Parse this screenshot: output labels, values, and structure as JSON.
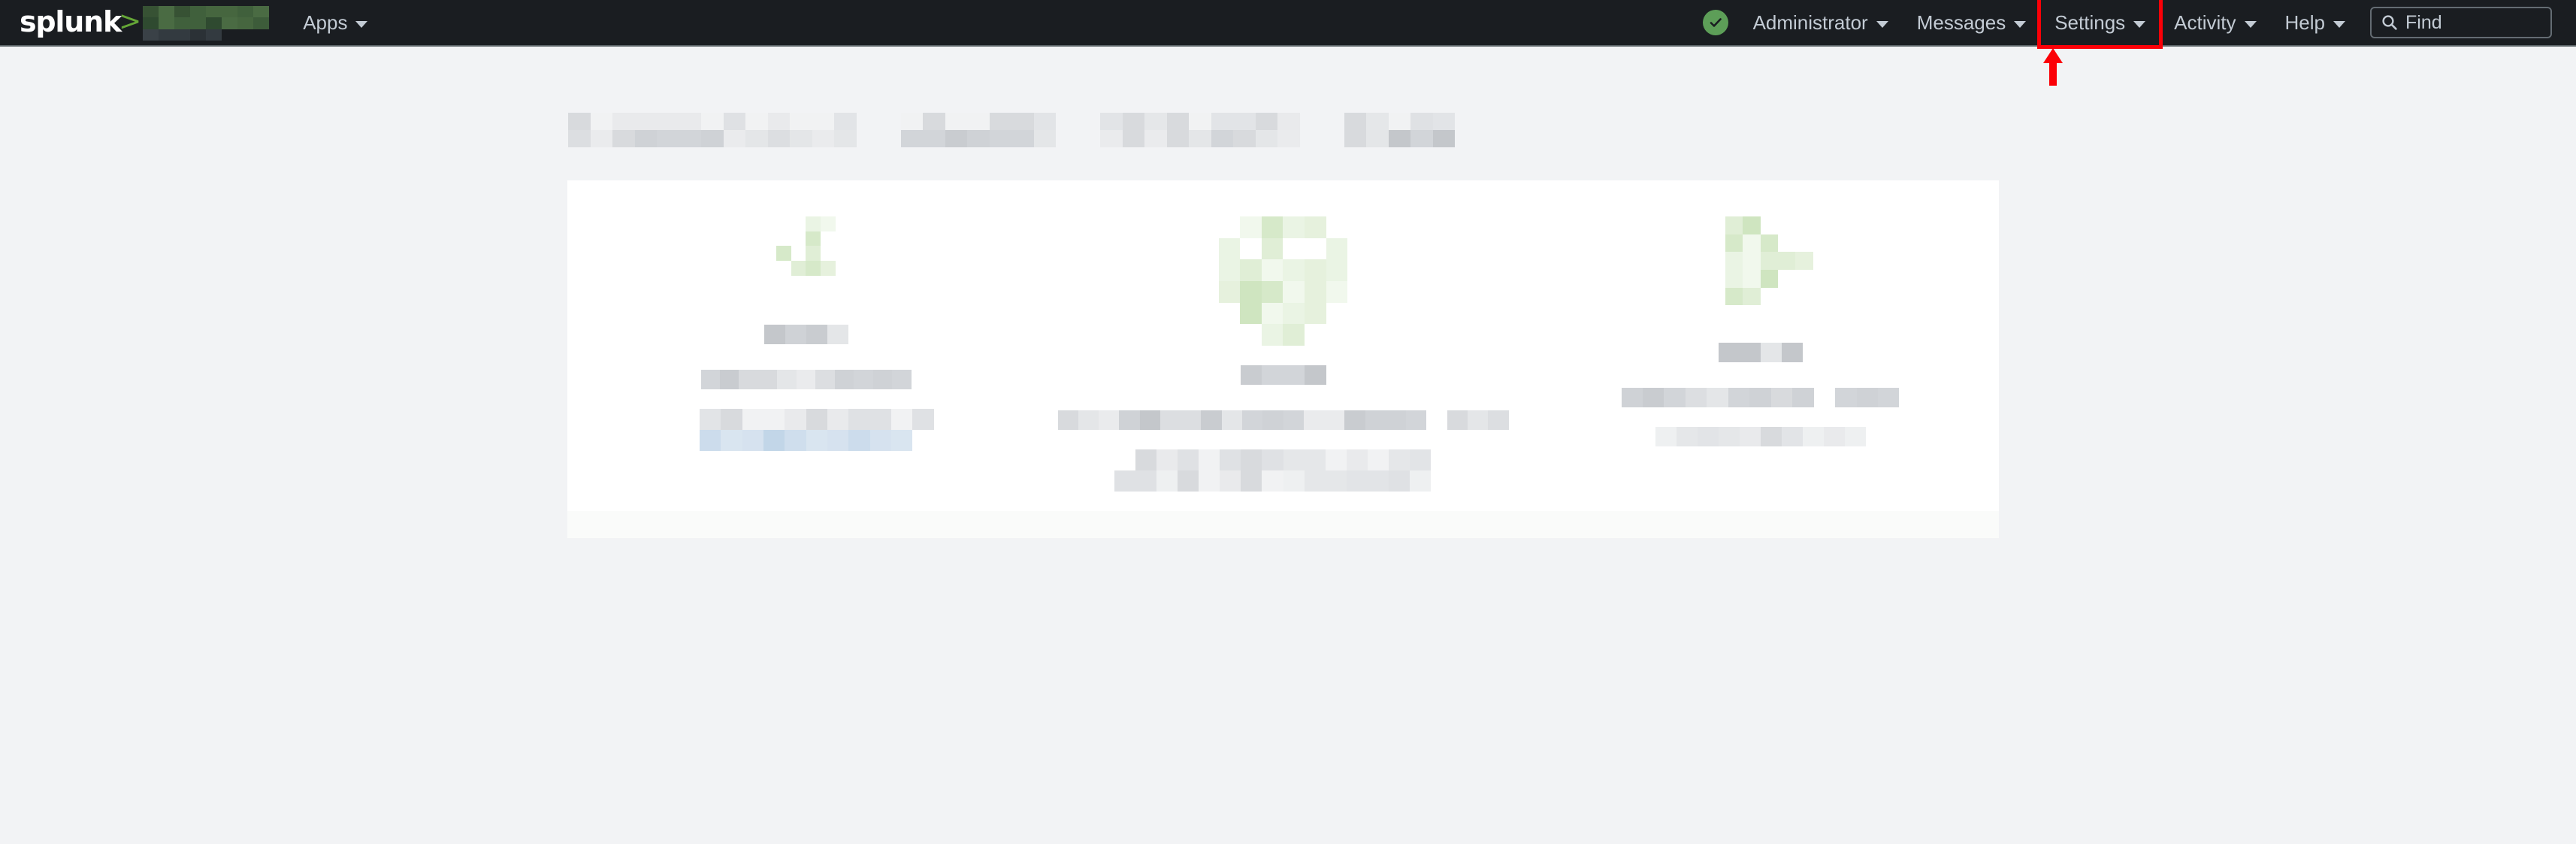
{
  "header": {
    "logo": {
      "wordmark": "splunk",
      "chevron": ">",
      "app_name_redacted": true
    },
    "nav_left": [
      {
        "name": "apps",
        "label": "Apps",
        "has_caret": true
      }
    ],
    "health_icon": "green-check-circle-icon",
    "nav_right": [
      {
        "name": "administrator",
        "label": "Administrator",
        "has_caret": true
      },
      {
        "name": "messages",
        "label": "Messages",
        "has_caret": true
      },
      {
        "name": "settings",
        "label": "Settings",
        "has_caret": true,
        "highlighted": true
      },
      {
        "name": "activity",
        "label": "Activity",
        "has_caret": true
      },
      {
        "name": "help",
        "label": "Help",
        "has_caret": true
      }
    ],
    "search": {
      "placeholder": "Find",
      "icon": "search-icon",
      "value": ""
    }
  },
  "annotation": {
    "highlight_target": "Settings",
    "highlight_color": "#fb0007",
    "arrow": "up-arrow",
    "arrow_color": "#fb0007"
  },
  "colors": {
    "header_bg": "#1a1d21",
    "page_bg": "#f2f3f5",
    "card_bg": "#ffffff",
    "accent_green": "#65a637",
    "status_green": "#5d9e58",
    "nav_text": "#c3cbd4",
    "annotation_red": "#fb0007",
    "redacted_gray": "#d5d8dc",
    "redacted_green": "#d6e9c9",
    "redacted_blue": "#ccdcec"
  },
  "main": {
    "page_title_redacted": true,
    "tiles": [
      {
        "name": "tile-1",
        "icon": "redacted-green-icon",
        "title_redacted": true,
        "description_redacted": true,
        "link_redacted": true,
        "link_is_blue": true
      },
      {
        "name": "tile-2",
        "icon": "redacted-green-icon",
        "title_redacted": true,
        "description_redacted": true,
        "link_redacted": true,
        "link_is_blue": false
      },
      {
        "name": "tile-3",
        "icon": "redacted-green-icon",
        "title_redacted": true,
        "description_redacted": true,
        "link_redacted": true,
        "link_is_blue": false
      }
    ]
  }
}
